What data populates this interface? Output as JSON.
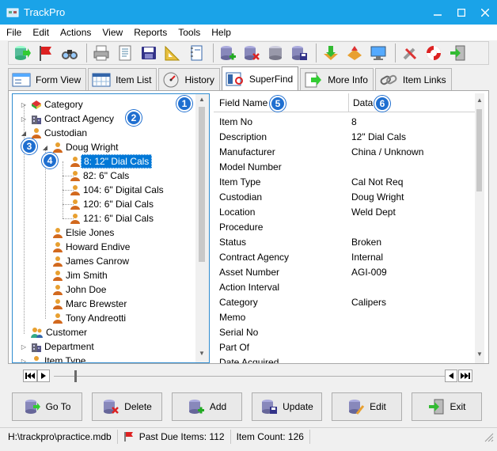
{
  "window": {
    "title": "TrackPro"
  },
  "menu": [
    "File",
    "Edit",
    "Actions",
    "View",
    "Reports",
    "Tools",
    "Help"
  ],
  "toolbar_icons": [
    "go-forward-icon",
    "flag-icon",
    "binoculars-icon",
    "printer-icon",
    "document-icon",
    "floppy-icon",
    "ruler-icon",
    "notebook-icon",
    "add-database-icon",
    "delete-database-icon",
    "database-icon",
    "save-database-icon",
    "download-icon",
    "import-icon",
    "monitor-icon",
    "wrench-icon",
    "lifebuoy-icon",
    "exit-icon"
  ],
  "tabs": [
    {
      "label": "Form View",
      "icon": "form-view-icon",
      "active": false
    },
    {
      "label": "Item List",
      "icon": "calendar-grid-icon",
      "active": false
    },
    {
      "label": "History",
      "icon": "gauge-icon",
      "active": false
    },
    {
      "label": "SuperFind",
      "icon": "superfind-icon",
      "active": true
    },
    {
      "label": "More Info",
      "icon": "arrow-page-icon",
      "active": false
    },
    {
      "label": "Item Links",
      "icon": "chain-link-icon",
      "active": false
    }
  ],
  "tree": [
    {
      "label": "Category",
      "indent": 0,
      "expander": "collapsed",
      "icon": "category-icon"
    },
    {
      "label": "Contract Agency",
      "indent": 0,
      "expander": "collapsed",
      "icon": "building-icon"
    },
    {
      "label": "Custodian",
      "indent": 0,
      "expander": "expanded",
      "icon": "person-icon"
    },
    {
      "label": "Doug Wright",
      "indent": 1,
      "expander": "expanded",
      "icon": "person-icon"
    },
    {
      "label": "8: 12\" Dial Cals",
      "indent": 2,
      "expander": "none",
      "icon": "person-icon",
      "selected": true
    },
    {
      "label": "82: 6\" Cals",
      "indent": 2,
      "expander": "none",
      "icon": "person-icon"
    },
    {
      "label": "104: 6\" Digital Cals",
      "indent": 2,
      "expander": "none",
      "icon": "person-icon"
    },
    {
      "label": "120: 6\" Dial Cals",
      "indent": 2,
      "expander": "none",
      "icon": "person-icon"
    },
    {
      "label": "121: 6\" Dial Cals",
      "indent": 2,
      "expander": "none",
      "icon": "person-icon"
    },
    {
      "label": "Elsie Jones",
      "indent": 1,
      "expander": "none",
      "icon": "person-icon"
    },
    {
      "label": "Howard Endive",
      "indent": 1,
      "expander": "none",
      "icon": "person-icon"
    },
    {
      "label": "James Canrow",
      "indent": 1,
      "expander": "none",
      "icon": "person-icon"
    },
    {
      "label": "Jim Smith",
      "indent": 1,
      "expander": "none",
      "icon": "person-icon"
    },
    {
      "label": "John Doe",
      "indent": 1,
      "expander": "none",
      "icon": "person-icon"
    },
    {
      "label": "Marc Brewster",
      "indent": 1,
      "expander": "none",
      "icon": "person-icon"
    },
    {
      "label": "Tony Andreotti",
      "indent": 1,
      "expander": "none",
      "icon": "person-icon"
    },
    {
      "label": "Customer",
      "indent": 0,
      "expander": "none",
      "icon": "customer-icon"
    },
    {
      "label": "Department",
      "indent": 0,
      "expander": "collapsed",
      "icon": "building-icon"
    },
    {
      "label": "Item Type",
      "indent": 0,
      "expander": "collapsed",
      "icon": "person-icon"
    }
  ],
  "grid": {
    "headers": {
      "field": "Field Name",
      "data": "Data"
    },
    "rows": [
      {
        "field": "Item No",
        "value": "8"
      },
      {
        "field": "Description",
        "value": "12\" Dial Cals"
      },
      {
        "field": "Manufacturer",
        "value": "China / Unknown"
      },
      {
        "field": "Model Number",
        "value": ""
      },
      {
        "field": "Item Type",
        "value": "Cal Not Req"
      },
      {
        "field": "Custodian",
        "value": "Doug Wright"
      },
      {
        "field": "Location",
        "value": "Weld Dept"
      },
      {
        "field": "Procedure",
        "value": ""
      },
      {
        "field": "Status",
        "value": "Broken"
      },
      {
        "field": "Contract Agency",
        "value": "Internal"
      },
      {
        "field": "Asset Number",
        "value": "AGI-009"
      },
      {
        "field": "Action Interval",
        "value": ""
      },
      {
        "field": "Category",
        "value": "Calipers"
      },
      {
        "field": "Memo",
        "value": ""
      },
      {
        "field": "Serial No",
        "value": ""
      },
      {
        "field": "Part Of",
        "value": ""
      },
      {
        "field": "Date Acquired",
        "value": ""
      }
    ]
  },
  "badges": [
    "1",
    "2",
    "3",
    "4",
    "5",
    "6"
  ],
  "buttons": [
    {
      "label": "Go To",
      "icon": "goto-database-icon"
    },
    {
      "label": "Delete",
      "icon": "delete-database-icon"
    },
    {
      "label": "Add",
      "icon": "add-database-icon"
    },
    {
      "label": "Update",
      "icon": "update-database-icon"
    },
    {
      "label": "Edit",
      "icon": "edit-database-icon"
    },
    {
      "label": "Exit",
      "icon": "exit-door-icon"
    }
  ],
  "status": {
    "path": "H:\\trackpro\\practice.mdb",
    "past_due": "Past Due Items: 112",
    "item_count": "Item Count: 126"
  },
  "colors": {
    "titlebar": "#1aa3e8",
    "selection": "#0078d7",
    "badge": "#1f6fd0",
    "tree_border": "#2f8cd0"
  }
}
